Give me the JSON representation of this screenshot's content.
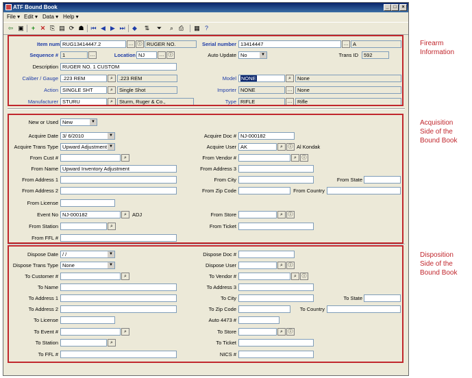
{
  "window": {
    "title": "ATF Bound Book"
  },
  "menu": [
    "File",
    "Edit",
    "Data",
    "Help"
  ],
  "firearm": {
    "item_number_label": "Item number",
    "item_number": "RUG13414447.2",
    "item_desc": "RUGER NO.",
    "serial_number_label": "Serial number",
    "serial_number": "13414447",
    "serial_flag": "A",
    "sequence_label": "Sequence #",
    "sequence": "1",
    "location_label": "Location",
    "location": "NJ",
    "auto_update_label": "Auto Update",
    "auto_update": "No",
    "trans_id_label": "Trans ID",
    "trans_id": "592",
    "description_label": "Description",
    "description": "RUGER NO. 1 CUSTOM",
    "caliber_label": "Caliber / Gauge",
    "caliber": ".223 REM",
    "caliber_desc": ".223 REM",
    "model_label": "Model",
    "model": "NONE",
    "model_desc": "None",
    "action_label": "Action",
    "action": "SINGLE SHT",
    "action_desc": "Single Shot",
    "importer_label": "Importer",
    "importer": "NONE",
    "importer_desc": "None",
    "manufacturer_label": "Manufacturer",
    "manufacturer": "STURU",
    "manufacturer_desc": "Sturm, Ruger & Co.,",
    "type_label": "Type",
    "type": "RIFLE",
    "type_desc": "Rifle"
  },
  "acquisition": {
    "new_or_used_label": "New or Used",
    "new_or_used": "New",
    "acquire_date_label": "Acquire Date",
    "acquire_date": "3/ 6/2010",
    "acquire_doc_label": "Acquire Doc #",
    "acquire_doc": "NJ-000182",
    "acquire_trans_type_label": "Acquire Trans Type",
    "acquire_trans_type": "Upward Adjustment",
    "acquire_user_label": "Acquire User",
    "acquire_user": "AK",
    "acquire_user_name": "Al Kondak",
    "from_cust_label": "From Cust #",
    "from_vendor_label": "From Vendor #",
    "from_name_label": "From Name",
    "from_name": "Upward Inventory Adjustment",
    "from_address3_label": "From Address 3",
    "from_address1_label": "From Address 1",
    "from_city_label": "From City",
    "from_state_label": "From State",
    "from_address2_label": "From Address 2",
    "from_zip_label": "From Zip Code",
    "from_country_label": "From Country",
    "from_license_label": "From License",
    "event_no_label": "Event No",
    "event_no": "NJ-000182",
    "event_desc": "ADJ",
    "from_store_label": "From Store",
    "from_station_label": "From Station",
    "from_ticket_label": "From Ticket",
    "from_ffl_label": "From FFL #"
  },
  "disposition": {
    "dispose_date_label": "Dispose Date",
    "dispose_date": " /  /",
    "dispose_doc_label": "Dispose Doc #",
    "dispose_trans_type_label": "Dispose Trans Type",
    "dispose_trans_type": "None",
    "dispose_user_label": "Dispose User",
    "to_customer_label": "To Customer #",
    "to_vendor_label": "To Vendor #",
    "to_name_label": "To Name",
    "to_address3_label": "To Address 3",
    "to_address1_label": "To Address 1",
    "to_city_label": "To City",
    "to_state_label": "To State",
    "to_address2_label": "To Address 2",
    "to_zip_label": "To Zip Code",
    "to_country_label": "To Country",
    "to_license_label": "To License",
    "auto4473_label": "Auto 4473 #",
    "to_event_label": "To Event #",
    "to_store_label": "To Store",
    "to_station_label": "To Station",
    "to_ticket_label": "To Ticket",
    "to_ffl_label": "To FFL #",
    "nics_label": "NICS #"
  },
  "notes": {
    "firearm": [
      "Firearm",
      "Information"
    ],
    "acquisition": [
      "Acquisition",
      "Side of the",
      "Bound Book"
    ],
    "disposition": [
      "Disposition",
      "Side of the",
      "Bound Book"
    ]
  },
  "colors": {
    "annotation_red": "#c0262c",
    "label_blue": "#1e3ca8",
    "window_bg": "#ece9d8"
  }
}
